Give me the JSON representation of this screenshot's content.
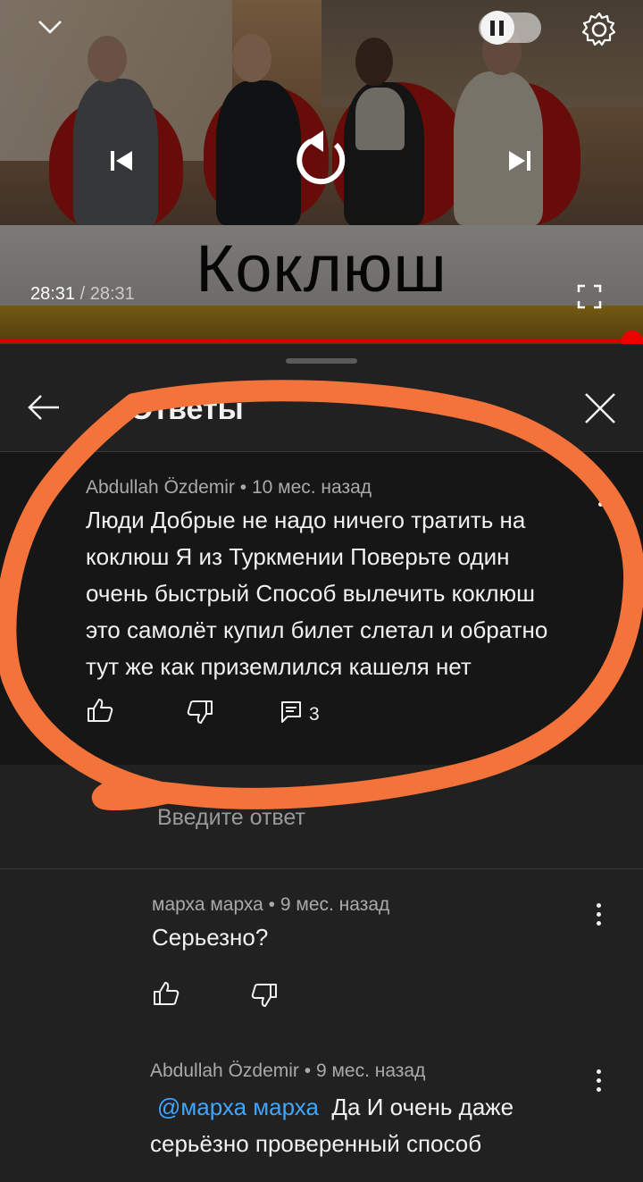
{
  "player": {
    "title_overlay": "Коклюш",
    "time_current": "28:31",
    "time_separator": "/",
    "time_total": "28:31",
    "progress_fraction": 1.0,
    "icons": [
      "chevron-down-icon",
      "pause-icon",
      "settings-gear-icon",
      "previous-icon",
      "replay-icon",
      "next-icon",
      "fullscreen-icon"
    ],
    "accent_color": "#ff0000"
  },
  "panel": {
    "title": "Ответы",
    "back_icon": "arrow-left-icon",
    "close_icon": "close-icon"
  },
  "main_comment": {
    "author": "Abdullah Özdemir",
    "time": "10 мес. назад",
    "lines": [
      "Люди Добрые не надо ничего тратить на",
      "коклюш Я из Туркмении Поверьте один",
      "очень быстрый Способ вылечить коклюш",
      "это самолёт купил билет слетал и обратно",
      "тут же как приземлился кашеля нет"
    ],
    "reply_count": "3"
  },
  "reply_input": {
    "placeholder": "Введите ответ"
  },
  "replies": [
    {
      "author": "марха марха",
      "time": "9 мес. назад",
      "text": "Серьезно?"
    },
    {
      "author": "Abdullah Özdemir",
      "time": "9 мес. назад",
      "mention": "@марха марха",
      "text_line1": "Да И очень даже",
      "text_line2": "серьёзно проверенный способ"
    }
  ],
  "annotation_color": "#f4733a"
}
